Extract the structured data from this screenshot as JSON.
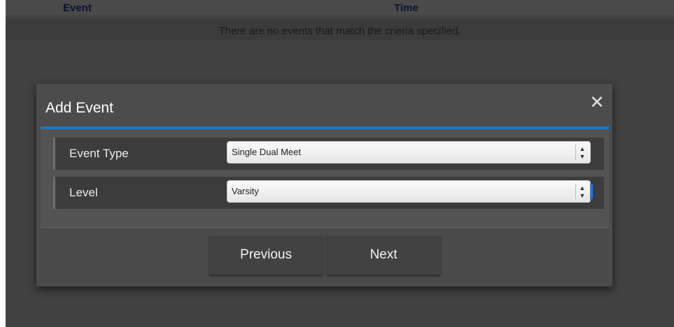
{
  "background_table": {
    "headers": [
      "Event",
      "Time"
    ],
    "empty_message": "There are no events that match the crieria specified."
  },
  "modal": {
    "title": "Add Event",
    "close_icon": "close-icon",
    "accent_color": "#1e78c6",
    "fields": [
      {
        "label": "Event Type",
        "value": "Single Dual Meet"
      },
      {
        "label": "Level",
        "value": "Varsity"
      }
    ],
    "buttons": {
      "previous": "Previous",
      "next": "Next"
    }
  }
}
